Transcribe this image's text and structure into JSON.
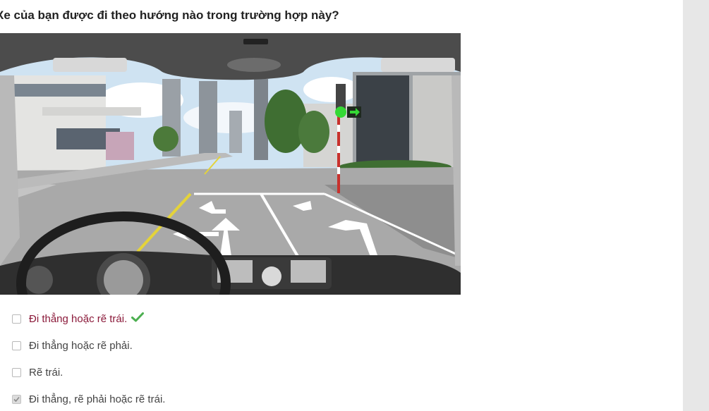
{
  "question": {
    "text": "Xe của bạn được đi theo hướng nào trong trường hợp này?"
  },
  "options": [
    {
      "label": "Đi thẳng hoặc rẽ trái.",
      "checked": false,
      "correct": true
    },
    {
      "label": "Đi thẳng hoặc rẽ phải.",
      "checked": false,
      "correct": false
    },
    {
      "label": "Rẽ trái.",
      "checked": false,
      "correct": false
    },
    {
      "label": "Đi thẳng, rẽ phải hoặc rẽ trái.",
      "checked": true,
      "correct": false
    }
  ],
  "colors": {
    "correct_text": "#8b1a3a",
    "check_mark": "#4caf50",
    "side_panel": "#e7e7e7"
  },
  "icons": {
    "correct": "check-mark-icon"
  }
}
